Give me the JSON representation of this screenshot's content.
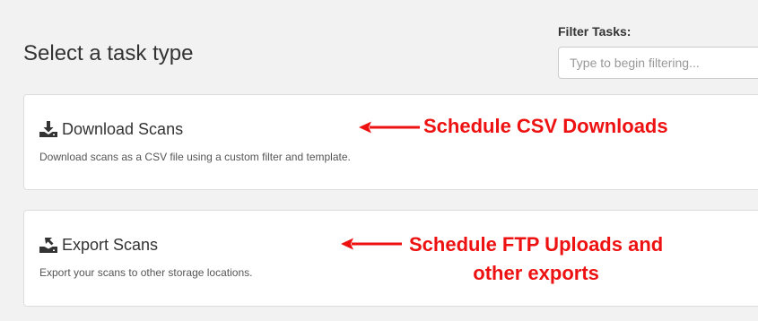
{
  "page": {
    "title": "Select a task type"
  },
  "filter": {
    "label": "Filter Tasks:",
    "placeholder": "Type to begin filtering...",
    "value": ""
  },
  "tasks": [
    {
      "title": "Download Scans",
      "description": "Download scans as a CSV file using a custom filter and template.",
      "icon": "download-icon"
    },
    {
      "title": "Export Scans",
      "description": "Export your scans to other storage locations.",
      "icon": "export-icon"
    }
  ],
  "annotations": [
    {
      "lines": [
        "Schedule CSV Downloads"
      ]
    },
    {
      "lines": [
        "Schedule FTP Uploads and",
        "other exports"
      ]
    }
  ],
  "colors": {
    "annotation": "#ee1111",
    "background": "#f2f2f2",
    "card_border": "#dddddd",
    "text": "#333333"
  }
}
